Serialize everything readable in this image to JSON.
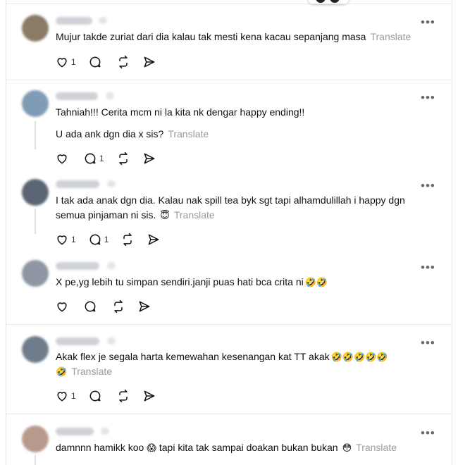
{
  "comments": [
    {
      "text": "Mujur takde zuriat dari dia kalau tak mesti kena kacau sepanjang masa",
      "translate": "Translate",
      "likes": "1",
      "replies": "",
      "avatar_color": "#8a7a66"
    },
    {
      "text": "Tahniah!!! Cerita mcm ni la kita nk dengar happy ending!!",
      "text2": "U ada ank dgn dia x sis?",
      "translate": "Translate",
      "likes": "",
      "replies": "1",
      "avatar_color": "#7f9bb5"
    },
    {
      "text": "I tak ada anak dgn dia. Kalau nak spill tea byk sgt tapi alhamdulillah i happy dgn",
      "text2": "semua pinjaman ni sis.",
      "emoji": "😇",
      "translate": "Translate",
      "likes": "1",
      "replies": "1",
      "avatar_color": "#5b6573"
    },
    {
      "text": "X pe,yg lebih tu simpan sendiri.janji puas hati bca crita ni",
      "emoji": "🤣🤣",
      "likes": "",
      "replies": "",
      "avatar_color": "#8e96a3"
    },
    {
      "text": "Akak flex je segala harta kemewahan kesenangan kat TT akak",
      "emoji": "🤣🤣🤣🤣🤣",
      "emoji2": "🤣",
      "translate": "Translate",
      "likes": "1",
      "replies": "",
      "avatar_color": "#6e7c8c"
    },
    {
      "text": "damnnn hamikk koo",
      "emoji": "😱",
      "text_b": "tapi kita tak sampai doakan bukan bukan",
      "emoji_b": "😳",
      "translate": "Translate",
      "likes": "",
      "replies": "",
      "avatar_color": "#b89a8c"
    }
  ],
  "more_label": "•••"
}
